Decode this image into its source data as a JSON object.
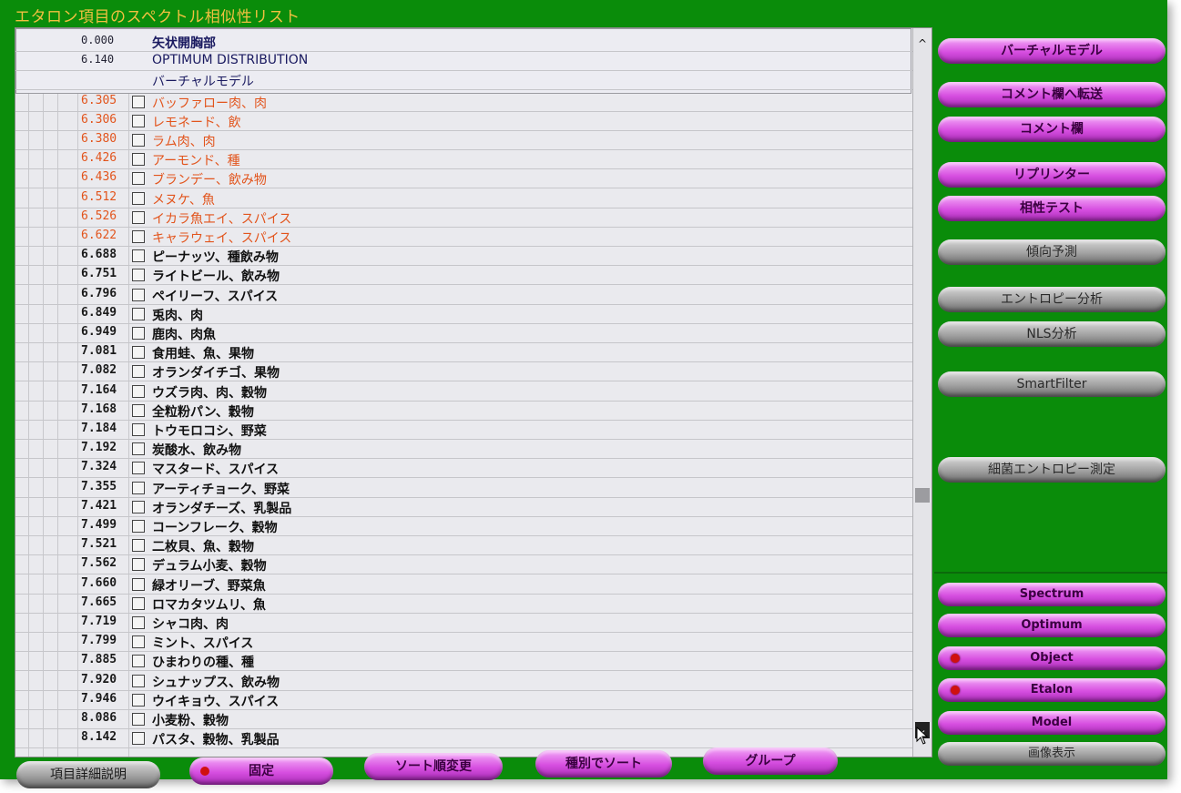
{
  "title": "エタロン項目のスペクトル相似性リスト",
  "header_rows": [
    {
      "score": "0.000",
      "name": "矢状開胸部"
    },
    {
      "score": "6.140",
      "name": "OPTIMUM DISTRIBUTION"
    },
    {
      "score": "",
      "name": "バーチャルモデル"
    }
  ],
  "rows": [
    {
      "score": "6.305",
      "name": "バッファロー肉、肉",
      "style": "orange"
    },
    {
      "score": "6.306",
      "name": "レモネード、飲",
      "style": "orange"
    },
    {
      "score": "6.380",
      "name": "ラム肉、肉",
      "style": "orange"
    },
    {
      "score": "6.426",
      "name": "アーモンド、種",
      "style": "orange"
    },
    {
      "score": "6.436",
      "name": "ブランデー、飲み物",
      "style": "orange"
    },
    {
      "score": "6.512",
      "name": "メヌケ、魚",
      "style": "orange"
    },
    {
      "score": "6.526",
      "name": "イカラ魚エイ、スパイス",
      "style": "orange"
    },
    {
      "score": "6.622",
      "name": "キャラウェイ、スパイス",
      "style": "orange"
    },
    {
      "score": "6.688",
      "name": "ピーナッツ、種飲み物",
      "style": "normal"
    },
    {
      "score": "6.751",
      "name": "ライトビール、飲み物",
      "style": "normal"
    },
    {
      "score": "6.796",
      "name": "ペイリーフ、スパイス",
      "style": "normal"
    },
    {
      "score": "6.849",
      "name": "兎肉、肉",
      "style": "normal"
    },
    {
      "score": "6.949",
      "name": "鹿肉、肉魚",
      "style": "normal"
    },
    {
      "score": "7.081",
      "name": "食用蛙、魚、果物",
      "style": "normal"
    },
    {
      "score": "7.082",
      "name": "オランダイチゴ、果物",
      "style": "normal"
    },
    {
      "score": "7.164",
      "name": "ウズラ肉、肉、穀物",
      "style": "normal"
    },
    {
      "score": "7.168",
      "name": "全粒粉パン、穀物",
      "style": "normal"
    },
    {
      "score": "7.184",
      "name": "トウモロコシ、野菜",
      "style": "normal"
    },
    {
      "score": "7.192",
      "name": "炭酸水、飲み物",
      "style": "normal"
    },
    {
      "score": "7.324",
      "name": "マスタード、スパイス",
      "style": "normal"
    },
    {
      "score": "7.355",
      "name": "アーティチョーク、野菜",
      "style": "normal"
    },
    {
      "score": "7.421",
      "name": "オランダチーズ、乳製品",
      "style": "normal"
    },
    {
      "score": "7.499",
      "name": "コーンフレーク、穀物",
      "style": "normal"
    },
    {
      "score": "7.521",
      "name": "二枚貝、魚、穀物",
      "style": "normal"
    },
    {
      "score": "7.562",
      "name": "デュラム小麦、穀物",
      "style": "normal"
    },
    {
      "score": "7.660",
      "name": "緑オリーブ、野菜魚",
      "style": "normal"
    },
    {
      "score": "7.665",
      "name": "ロマカタツムリ、魚",
      "style": "normal"
    },
    {
      "score": "7.719",
      "name": "シャコ肉、肉",
      "style": "normal"
    },
    {
      "score": "7.799",
      "name": "ミント、スパイス",
      "style": "normal"
    },
    {
      "score": "7.885",
      "name": "ひまわりの種、種",
      "style": "normal"
    },
    {
      "score": "7.920",
      "name": "シュナップス、飲み物",
      "style": "normal"
    },
    {
      "score": "7.946",
      "name": "ウイキョウ、スパイス",
      "style": "normal"
    },
    {
      "score": "8.086",
      "name": "小麦粉、穀物",
      "style": "normal"
    },
    {
      "score": "8.142",
      "name": "パスタ、穀物、乳製品",
      "style": "normal"
    }
  ],
  "right_buttons": {
    "virtual_model": "バーチャルモデル",
    "transfer_comment": "コメント欄へ転送",
    "comment": "コメント欄",
    "reprinter": "リプリンター",
    "compat_test": "相性テスト",
    "trend": "傾向予測",
    "entropy": "エントロピー分析",
    "nls": "NLS分析",
    "smartfilter": "SmartFilter",
    "bacteria": "細菌エントロピー測定",
    "spectrum": "Spectrum",
    "optimum": "Optimum",
    "object": "Object",
    "etalon": "Etalon",
    "model": "Model",
    "image": "画像表示"
  },
  "bottom_buttons": {
    "detail": "項目詳細説明",
    "fix": "固定",
    "sort_order": "ソート順変更",
    "sort_type": "種別でソート",
    "group": "グループ"
  },
  "colors": {
    "background": "#0a8c0a",
    "title": "#f0c040",
    "button_pink": "#d64ee0",
    "button_gray": "#a0a0a0",
    "highlight_text": "#e2541c"
  }
}
